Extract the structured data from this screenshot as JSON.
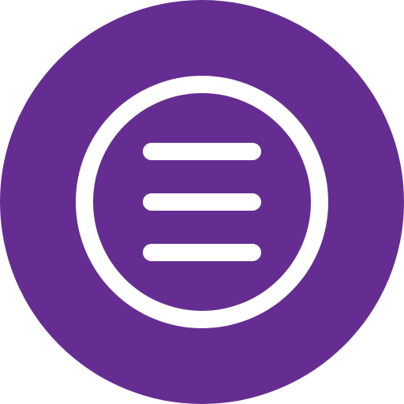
{
  "icon": {
    "name": "hamburger-menu-icon",
    "background_color": "#652D91",
    "foreground_color": "#FFFFFF"
  }
}
